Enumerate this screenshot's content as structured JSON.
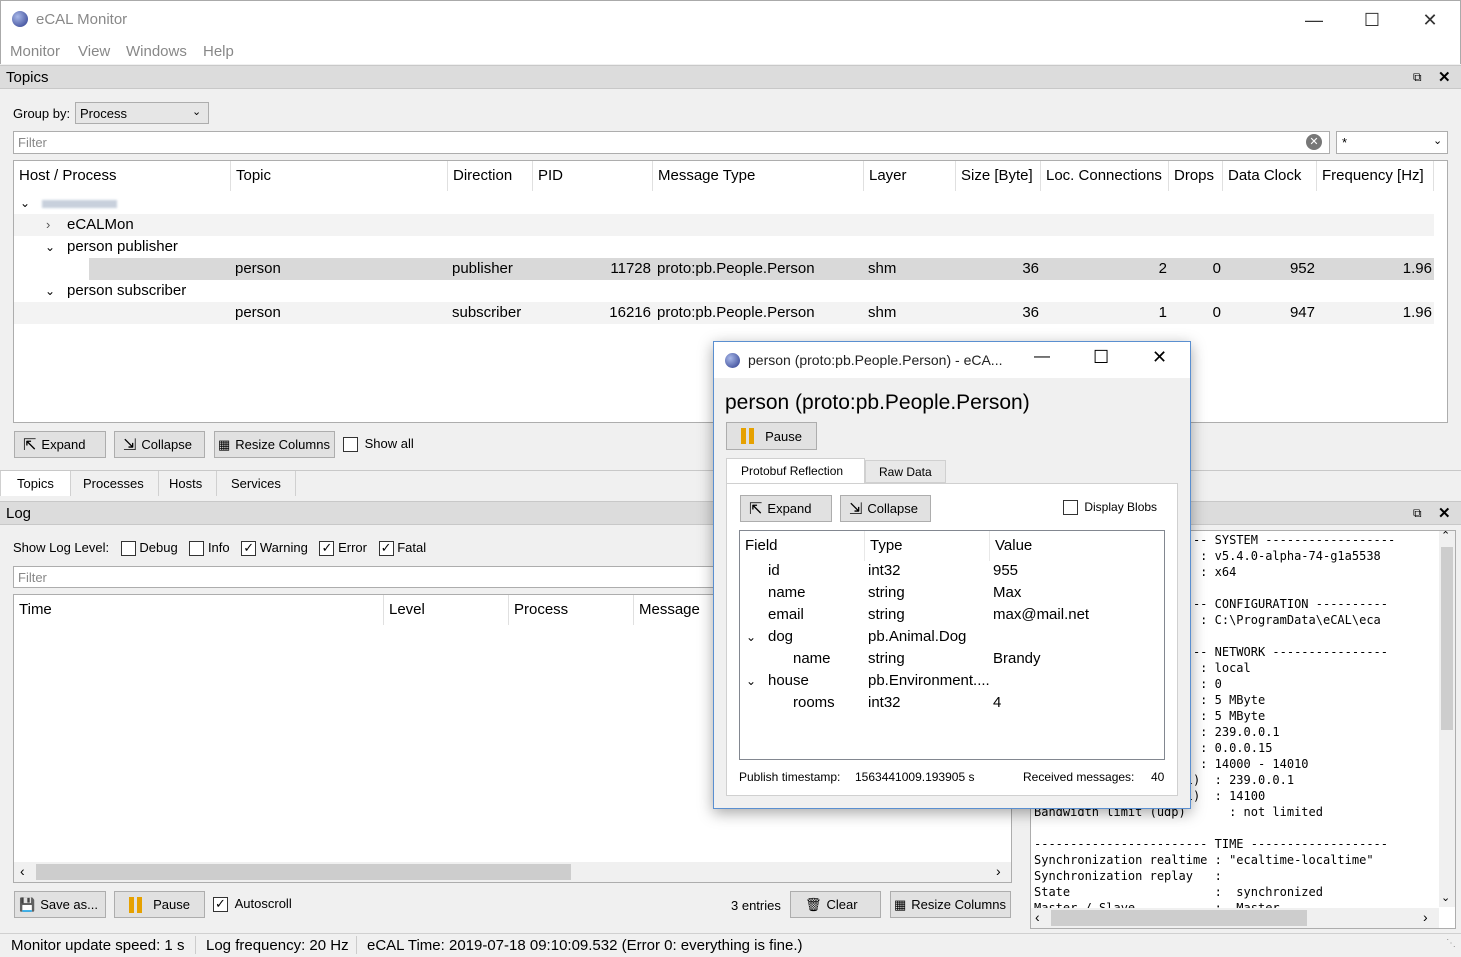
{
  "window": {
    "title": "eCAL Monitor"
  },
  "menu": [
    "Monitor",
    "View",
    "Windows",
    "Help"
  ],
  "topics_panel": {
    "title": "Topics",
    "group_by_label": "Group by:",
    "group_by_value": "Process",
    "filter_placeholder": "Filter",
    "filter_mode": "*",
    "columns": [
      "Host / Process",
      "Topic",
      "Direction",
      "PID",
      "Message Type",
      "Layer",
      "Size [Byte]",
      "Loc. Connections",
      "Drops",
      "Data Clock",
      "Frequency [Hz]"
    ],
    "tree": {
      "host": "",
      "processes": [
        {
          "name": "eCALMon"
        },
        {
          "name": "person publisher",
          "topic": "person",
          "direction": "publisher",
          "pid": "11728",
          "type": "proto:pb.People.Person",
          "layer": "shm",
          "size": "36",
          "conn": "2",
          "drops": "0",
          "clock": "952",
          "freq": "1.96"
        },
        {
          "name": "person subscriber",
          "topic": "person",
          "direction": "subscriber",
          "pid": "16216",
          "type": "proto:pb.People.Person",
          "layer": "shm",
          "size": "36",
          "conn": "1",
          "drops": "0",
          "clock": "947",
          "freq": "1.96"
        }
      ]
    },
    "expand": "Expand",
    "collapse": "Collapse",
    "resize_columns": "Resize Columns",
    "show_all": "Show all"
  },
  "tabs": [
    "Topics",
    "Processes",
    "Hosts",
    "Services"
  ],
  "log_panel": {
    "title": "Log",
    "show_level_label": "Show Log Level:",
    "levels": [
      {
        "name": "Debug",
        "checked": false
      },
      {
        "name": "Info",
        "checked": false
      },
      {
        "name": "Warning",
        "checked": true
      },
      {
        "name": "Error",
        "checked": true
      },
      {
        "name": "Fatal",
        "checked": true
      }
    ],
    "filter_placeholder": "Filter",
    "columns": [
      "Time",
      "Level",
      "Process",
      "Message"
    ],
    "save_as": "Save as...",
    "pause": "Pause",
    "autoscroll": "Autoscroll",
    "entries": "3 entries",
    "clear": "Clear",
    "resize_columns": "Resize Columns"
  },
  "system_info": [
    "------------------------ SYSTEM ------------------",
    "                       : v5.4.0-alpha-74-g1a5538",
    "                       : x64",
    "",
    "------------------------ CONFIGURATION ----------",
    "                       : C:\\ProgramData\\eCAL\\eca",
    "",
    "------------------------ NETWORK ----------------",
    "                       : local",
    "                       : 0",
    "                       : 5 MByte",
    "                       : 5 MByte",
    "                       : 239.0.0.1",
    "                       : 0.0.0.15",
    "                       : 14000 - 14010",
    "                   cal)  : 239.0.0.1",
    "                   cal)  : 14100",
    "Bandwidth limit (udp)      : not limited",
    "",
    "------------------------ TIME -------------------",
    "Synchronization realtime : \"ecaltime-localtime\"",
    "Synchronization replay   :",
    "State                    :  synchronized",
    "Master / Slave           :  Master"
  ],
  "statusbar": {
    "update_speed": "Monitor update speed: 1 s",
    "log_freq": "Log frequency: 20 Hz",
    "ecal_time": "eCAL Time: 2019-07-18 09:10:09.532 (Error 0: everything is fine.)"
  },
  "dialog": {
    "title": "person (proto:pb.People.Person) - eCA...",
    "heading": "person (proto:pb.People.Person)",
    "pause": "Pause",
    "tabs": [
      "Protobuf Reflection",
      "Raw Data"
    ],
    "expand": "Expand",
    "collapse": "Collapse",
    "display_blobs": "Display Blobs",
    "columns": [
      "Field",
      "Type",
      "Value"
    ],
    "rows": [
      {
        "field": "id",
        "type": "int32",
        "value": "955",
        "level": 0,
        "arrow": ""
      },
      {
        "field": "name",
        "type": "string",
        "value": "Max",
        "level": 0,
        "arrow": ""
      },
      {
        "field": "email",
        "type": "string",
        "value": "max@mail.net",
        "level": 0,
        "arrow": ""
      },
      {
        "field": "dog",
        "type": "pb.Animal.Dog",
        "value": "",
        "level": 0,
        "arrow": "v"
      },
      {
        "field": "name",
        "type": "string",
        "value": "Brandy",
        "level": 1,
        "arrow": ""
      },
      {
        "field": "house",
        "type": "pb.Environment....",
        "value": "",
        "level": 0,
        "arrow": "v"
      },
      {
        "field": "rooms",
        "type": "int32",
        "value": "4",
        "level": 1,
        "arrow": ""
      }
    ],
    "publish_ts_label": "Publish timestamp:",
    "publish_ts": "1563441009.193905 s",
    "received_label": "Received messages:",
    "received": "40"
  }
}
